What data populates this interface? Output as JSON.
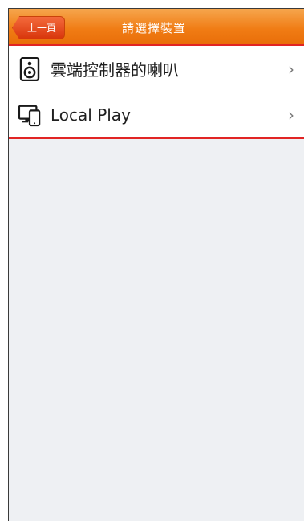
{
  "navbar": {
    "back_label": "上一頁",
    "title": "請選擇裝置"
  },
  "devices": [
    {
      "icon": "speaker-icon",
      "label": "雲端控制器的喇叭",
      "chevron": "›"
    },
    {
      "icon": "devices-icon",
      "label": "Local Play",
      "chevron": "›"
    }
  ],
  "colors": {
    "navbar": "#f07c14",
    "back_button": "#d8360c",
    "selection_border": "#e12424",
    "background": "#eef0f3"
  }
}
